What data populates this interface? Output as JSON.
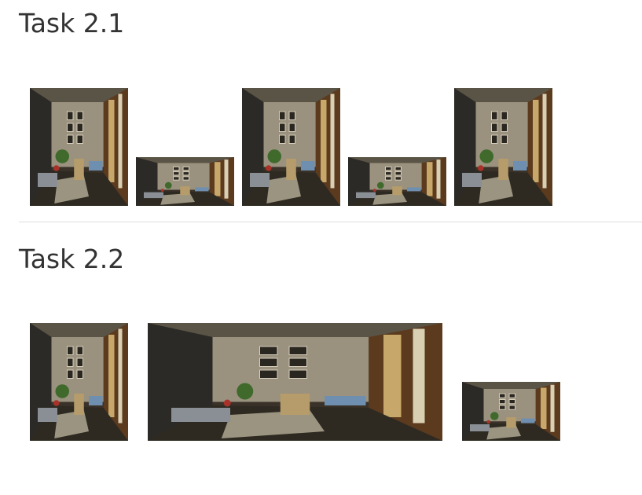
{
  "tasks": [
    {
      "title": "Task 2.1",
      "images": [
        {
          "kind": "portrait-lounge"
        },
        {
          "kind": "landscape-lounge"
        },
        {
          "kind": "portrait-lounge"
        },
        {
          "kind": "landscape-lounge"
        },
        {
          "kind": "portrait-lounge"
        }
      ]
    },
    {
      "title": "Task 2.2",
      "images": [
        {
          "kind": "portrait-lounge"
        },
        {
          "kind": "wide-lounge"
        },
        {
          "kind": "landscape-lounge"
        }
      ]
    }
  ]
}
